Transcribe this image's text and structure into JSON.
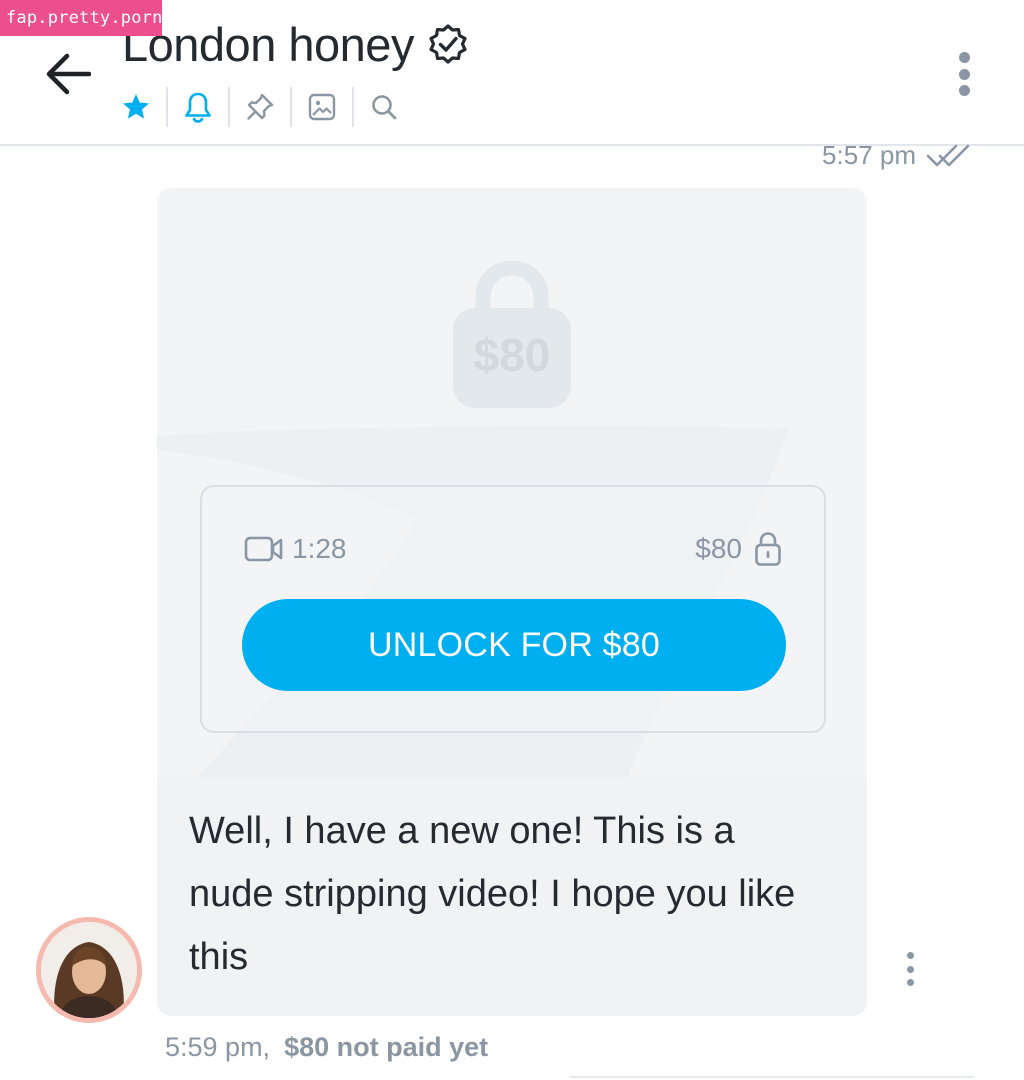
{
  "watermark": "fap.pretty.porn",
  "header": {
    "title": "London honey",
    "verified_icon": "verified-badge-icon",
    "toolbar": [
      "star-icon",
      "bell-icon",
      "pin-icon",
      "image-icon",
      "search-icon"
    ]
  },
  "messages": [
    {
      "time": "5:57 pm",
      "status_icon": "double-check-icon"
    },
    {
      "media": {
        "lock_price": "$80",
        "duration": "1:28",
        "price": "$80",
        "unlock_label": "UNLOCK FOR $80"
      },
      "text": "Well, I have a new one! This is a nude stripping video! I hope you like this",
      "time": "5:59 pm,",
      "payment_status": "$80 not paid yet"
    }
  ],
  "colors": {
    "accent": "#00aff0",
    "muted": "#8a96a3",
    "text": "#242a30",
    "bubble": "#f0f2f4",
    "watermark_bg": "#ec4f8e"
  }
}
